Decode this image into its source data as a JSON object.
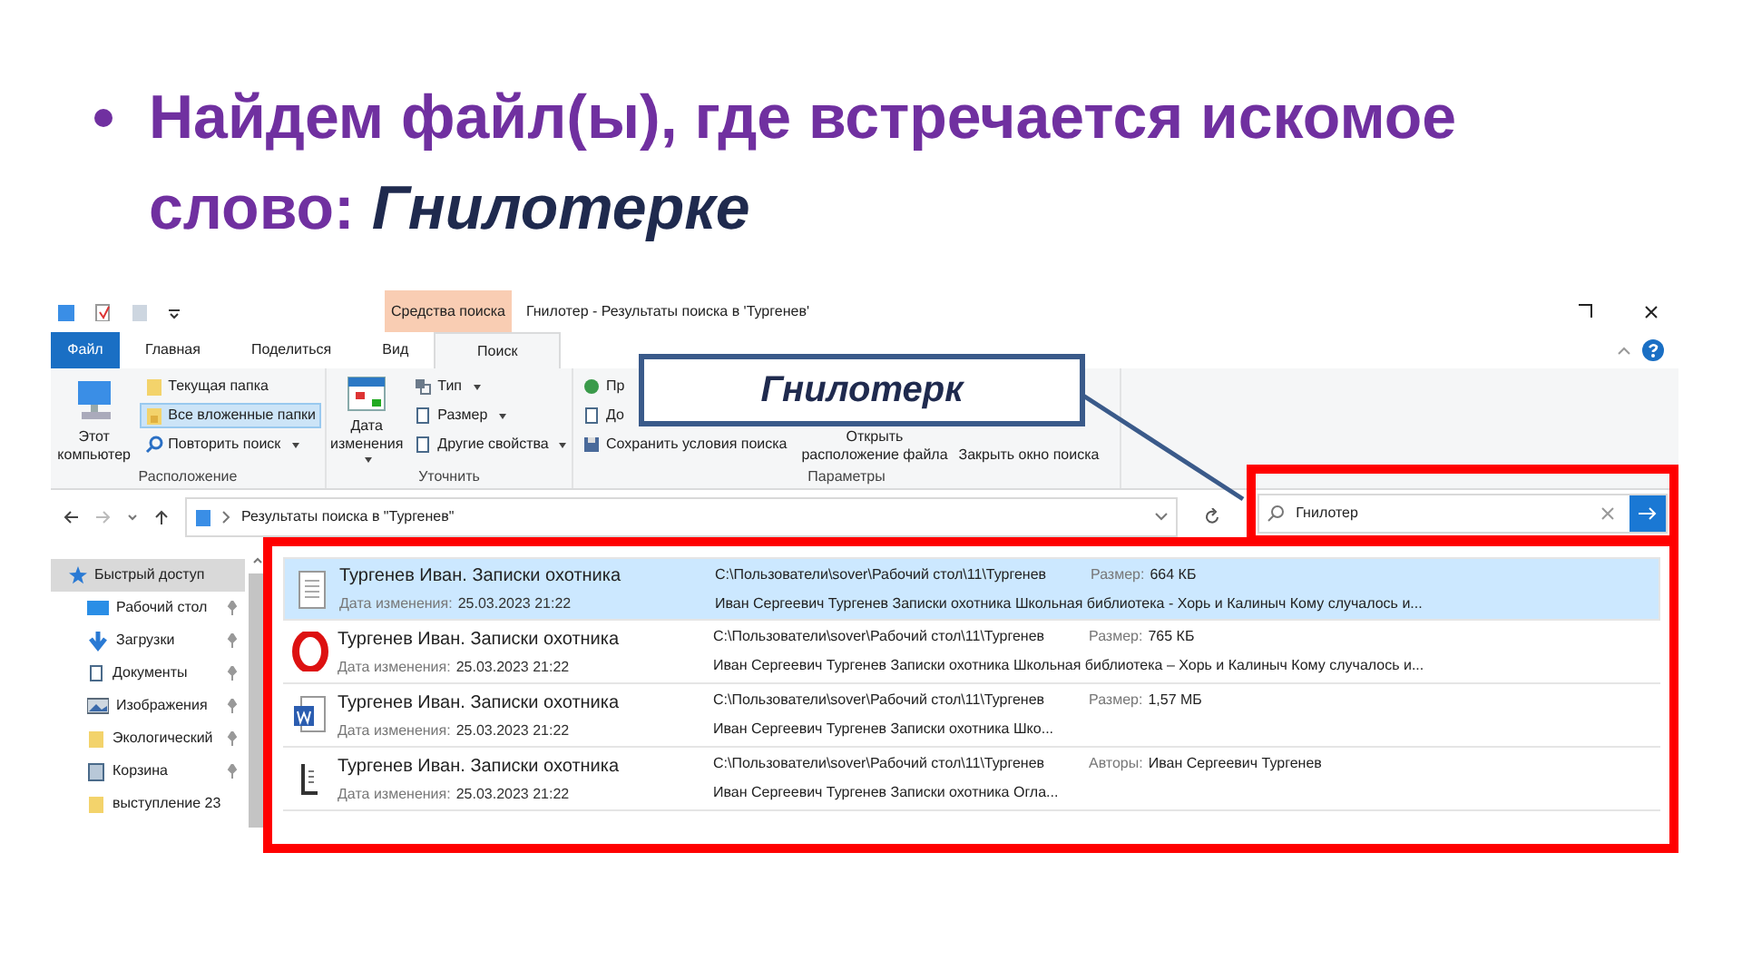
{
  "slide": {
    "heading": "Найдем файл(ы), где встречается искомое слово: *Гнилотерке*"
  },
  "window": {
    "contextual_tab": "Средства поиска",
    "title": "Гнилотер - Результаты поиска в 'Тургенев'",
    "ribbon_tabs": [
      {
        "label": "Файл",
        "selected": false,
        "kind": "file"
      },
      {
        "label": "Главная",
        "selected": false,
        "kind": "tab"
      },
      {
        "label": "Поделиться",
        "selected": false,
        "kind": "tab"
      },
      {
        "label": "Вид",
        "selected": false,
        "kind": "tab"
      },
      {
        "label": "Поиск",
        "selected": true,
        "kind": "tab"
      }
    ],
    "ribbon_groups": [
      {
        "label": "Расположение",
        "large": [
          {
            "label": "Этот компьютер",
            "dropdown": false
          }
        ],
        "small": [
          {
            "label": "Текущая папка",
            "dropdown": false,
            "selected": false
          },
          {
            "label": "Все вложенные папки",
            "dropdown": false,
            "selected": true
          },
          {
            "label": "Повторить поиск",
            "dropdown": true,
            "selected": false
          }
        ]
      },
      {
        "label": "Уточнить",
        "large": [
          {
            "label": "Дата изменения",
            "dropdown": true
          }
        ],
        "small": [
          {
            "label": "Тип",
            "dropdown": true,
            "selected": false
          },
          {
            "label": "Размер",
            "dropdown": true,
            "selected": false
          },
          {
            "label": "Другие свойства",
            "dropdown": true,
            "selected": false
          }
        ]
      },
      {
        "label": "Параметры",
        "small": [
          {
            "label": "Пр",
            "dropdown": false,
            "selected": false
          },
          {
            "label": "До",
            "dropdown": false,
            "selected": false
          },
          {
            "label": "Сохранить условия поиска",
            "dropdown": false,
            "selected": false
          }
        ],
        "large": [
          {
            "label": "Открыть расположение файла",
            "dropdown": false
          },
          {
            "label": "Закрыть окно поиска",
            "dropdown": false
          }
        ]
      }
    ],
    "address": "Результаты поиска в \"Тургенев\"",
    "search": {
      "value": "Гнилотер"
    },
    "nav": [
      {
        "label": "Быстрый доступ",
        "kind": "star",
        "pinned": false,
        "selected": true
      },
      {
        "label": "Рабочий стол",
        "kind": "desktop",
        "pinned": true,
        "selected": false
      },
      {
        "label": "Загрузки",
        "kind": "download",
        "pinned": true,
        "selected": false
      },
      {
        "label": "Документы",
        "kind": "doc",
        "pinned": true,
        "selected": false
      },
      {
        "label": "Изображения",
        "kind": "image",
        "pinned": true,
        "selected": false
      },
      {
        "label": "Экологический",
        "kind": "folder",
        "pinned": true,
        "selected": false
      },
      {
        "label": "Корзина",
        "kind": "bin",
        "pinned": true,
        "selected": false
      },
      {
        "label": "выступление 23",
        "kind": "folder",
        "pinned": false,
        "selected": false
      }
    ],
    "results": [
      {
        "kind": "text",
        "title": "Тургенев Иван. Записки охотника",
        "date_label": "Дата изменения:",
        "date": "25.03.2023 21:22",
        "path": "C:\\Пользователи\\sover\\Рабочий стол\\11\\Тургенев",
        "snippet": "Иван Сергеевич Тургенев Записки охотника Школьная библиотека - Хорь и Калиныч Кому случалось и...",
        "info_label": "Размер:",
        "info_value": "664 КБ",
        "selected": true
      },
      {
        "kind": "opera",
        "title": "Тургенев Иван. Записки охотника",
        "date_label": "Дата изменения:",
        "date": "25.03.2023 21:22",
        "path": "C:\\Пользователи\\sover\\Рабочий стол\\11\\Тургенев",
        "snippet": "Иван Сергеевич Тургенев Записки охотника Школьная библиотека – Хорь и Калиныч Кому случалось и...",
        "info_label": "Размер:",
        "info_value": "765 КБ",
        "selected": false
      },
      {
        "kind": "word",
        "title": "Тургенев Иван. Записки охотника",
        "date_label": "Дата изменения:",
        "date": "25.03.2023 21:22",
        "path": "C:\\Пользователи\\sover\\Рабочий стол\\11\\Тургенев",
        "snippet": "Иван Сергеевич Тургенев Записки охотника Шко...",
        "info_label": "Размер:",
        "info_value": "1,57 МБ",
        "selected": false
      },
      {
        "kind": "fb2",
        "title": "Тургенев Иван. Записки охотника",
        "date_label": "Дата изменения:",
        "date": "25.03.2023 21:22",
        "path": "C:\\Пользователи\\sover\\Рабочий стол\\11\\Тургенев",
        "snippet": "Иван Сергеевич Тургенев Записки охотника Огла...",
        "info_label": "Авторы:",
        "info_value": "Иван Сергеевич Тургенев",
        "selected": false
      }
    ]
  },
  "callout": {
    "text": "Гнилотерк"
  }
}
